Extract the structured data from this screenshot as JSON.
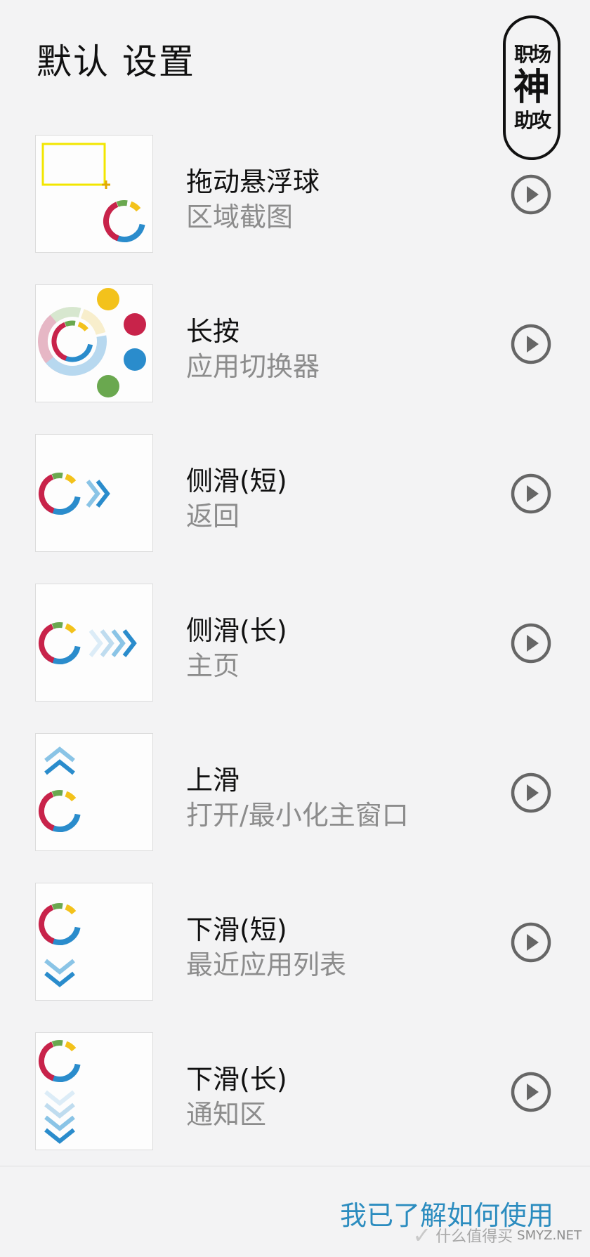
{
  "header": {
    "title": "默认 设置"
  },
  "stamp": {
    "top_left": "职",
    "top_right": "场",
    "middle": "神",
    "bottom_left": "助",
    "bottom_right": "攻"
  },
  "gestures": [
    {
      "title": "拖动悬浮球",
      "subtitle": "区域截图",
      "icon": "drag-select-icon"
    },
    {
      "title": "长按",
      "subtitle": "应用切换器",
      "icon": "long-press-icon"
    },
    {
      "title": "侧滑(短)",
      "subtitle": "返回",
      "icon": "swipe-short-icon"
    },
    {
      "title": "侧滑(长)",
      "subtitle": "主页",
      "icon": "swipe-long-icon"
    },
    {
      "title": "上滑",
      "subtitle": "打开/最小化主窗口",
      "icon": "swipe-up-icon"
    },
    {
      "title": "下滑(短)",
      "subtitle": "最近应用列表",
      "icon": "swipe-down-short-icon"
    },
    {
      "title": "下滑(长)",
      "subtitle": "通知区",
      "icon": "swipe-down-long-icon"
    }
  ],
  "footer": {
    "confirm_label": "我已了解如何使用"
  },
  "watermark": {
    "brand": "什么值得买",
    "site": "SMYZ.NET"
  },
  "colors": {
    "accent_blue": "#2b8cbf",
    "ring_red": "#c8234a",
    "ring_blue": "#2a8ccc",
    "ring_yellow": "#f3c21b",
    "ring_green": "#6aa84f",
    "play_icon": "#666666"
  }
}
